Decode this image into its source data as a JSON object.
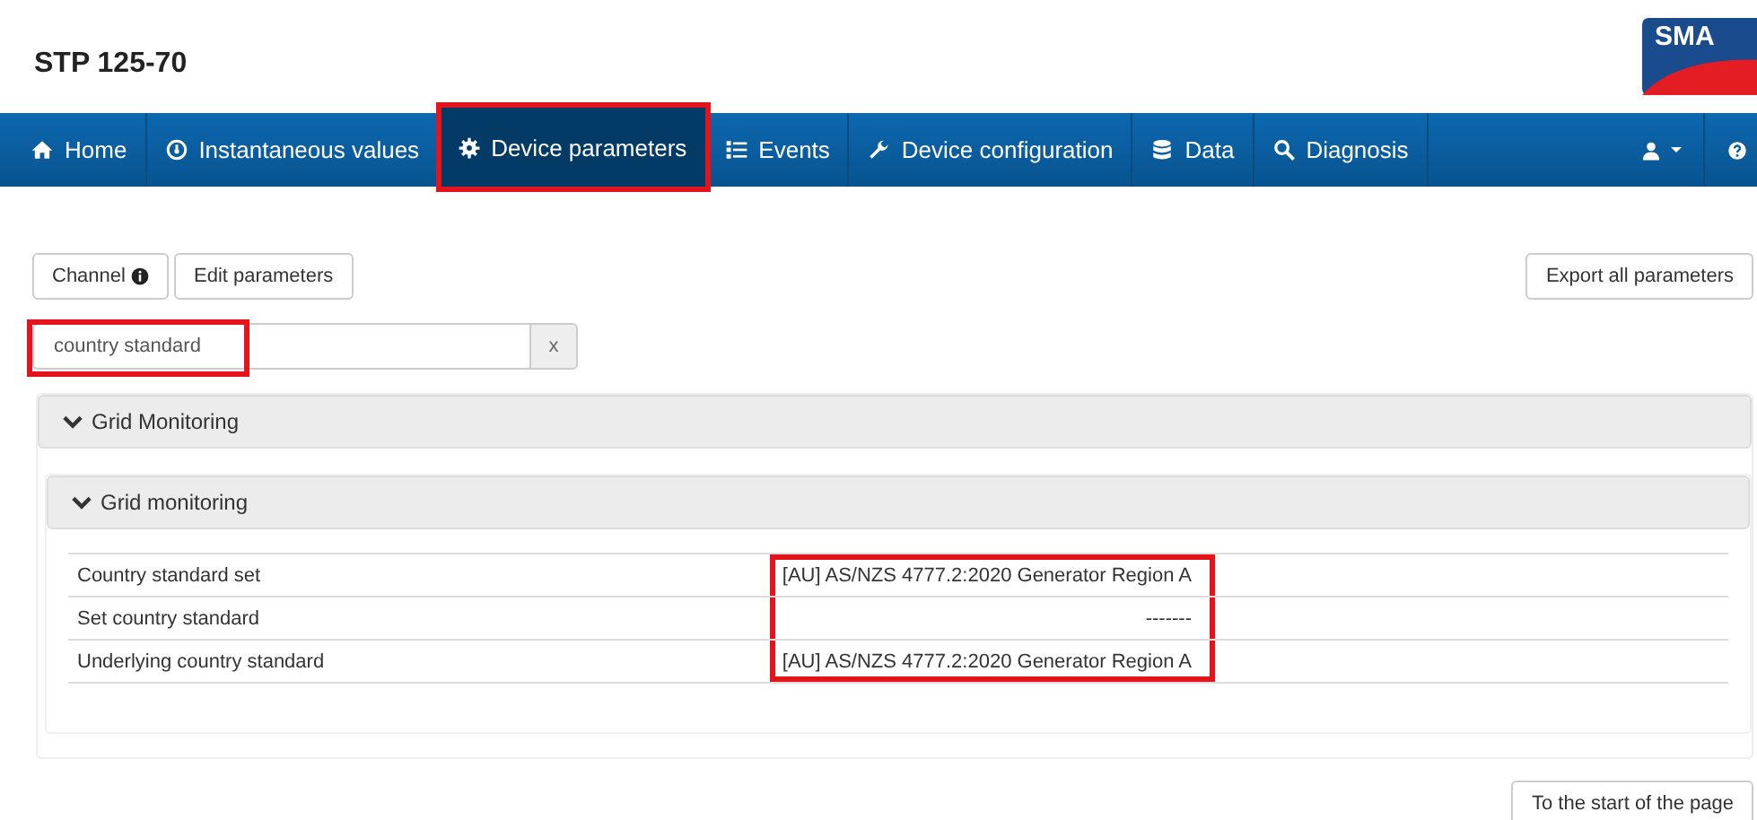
{
  "header": {
    "title": "STP 125-70",
    "logo": "SMA"
  },
  "nav": {
    "tabs": [
      {
        "label": "Home",
        "selected": false,
        "highlighted": false
      },
      {
        "label": "Instantaneous values",
        "selected": false,
        "highlighted": false
      },
      {
        "label": "Device parameters",
        "selected": true,
        "highlighted": true
      },
      {
        "label": "Events",
        "selected": false,
        "highlighted": false
      },
      {
        "label": "Device configuration",
        "selected": false,
        "highlighted": false
      },
      {
        "label": "Data",
        "selected": false,
        "highlighted": false
      },
      {
        "label": "Diagnosis",
        "selected": false,
        "highlighted": false
      }
    ]
  },
  "toolbar": {
    "left_buttons": [
      {
        "label": "Channel",
        "info": true
      },
      {
        "label": "Edit parameters",
        "info": false
      }
    ],
    "right_button": "Export all parameters"
  },
  "search": {
    "value": "country standard",
    "highlighted": true,
    "clear": "x"
  },
  "group": {
    "title": "Grid Monitoring",
    "expanded": true,
    "subgroup": {
      "title": "Grid monitoring",
      "expanded": true,
      "rows": [
        {
          "name": "Country standard set",
          "value": "[AU] AS/NZS 4777.2:2020 Generator Region A",
          "highlighted": true
        },
        {
          "name": "Set country standard",
          "value": "-------",
          "highlighted": true
        },
        {
          "name": "Underlying country standard",
          "value": "[AU] AS/NZS 4777.2:2020 Generator Region A",
          "highlighted": true
        }
      ]
    }
  },
  "footer_button": "To the start of the page"
}
